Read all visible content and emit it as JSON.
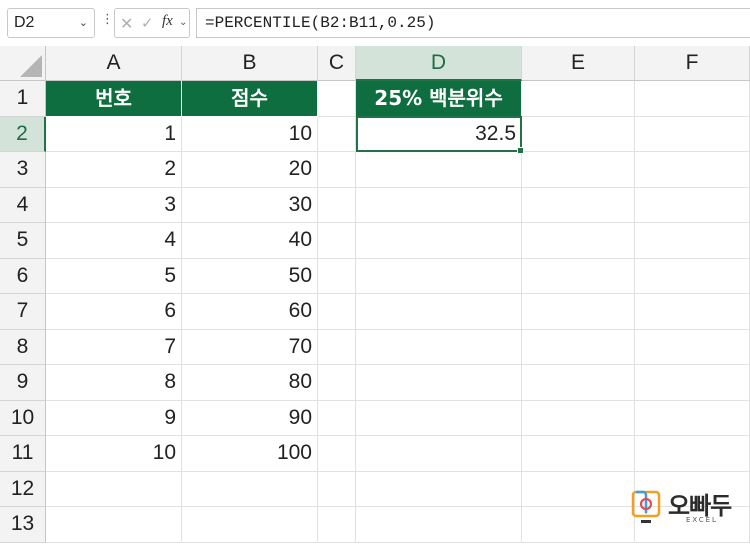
{
  "formula_bar": {
    "name_box": "D2",
    "cancel_glyph": "✕",
    "enter_glyph": "✓",
    "fx_label": "fx",
    "formula": "=PERCENTILE(B2:B11,0.25)"
  },
  "columns": [
    "A",
    "B",
    "C",
    "D",
    "E",
    "F"
  ],
  "rows": [
    "1",
    "2",
    "3",
    "4",
    "5",
    "6",
    "7",
    "8",
    "9",
    "10",
    "11",
    "12",
    "13"
  ],
  "cells": {
    "A1": "번호",
    "B1": "점수",
    "D1": "25% 백분위수",
    "A": [
      "1",
      "2",
      "3",
      "4",
      "5",
      "6",
      "7",
      "8",
      "9",
      "10"
    ],
    "B": [
      "10",
      "20",
      "30",
      "40",
      "50",
      "60",
      "70",
      "80",
      "90",
      "100"
    ],
    "D2": "32.5"
  },
  "active": {
    "column": "D",
    "row": "2"
  },
  "colors": {
    "header_fill": "#0f6e3f",
    "selection": "#217346"
  },
  "logo": {
    "brand": "오빠두",
    "sub": "EXCEL",
    "icon": "monitor-logo-icon"
  }
}
